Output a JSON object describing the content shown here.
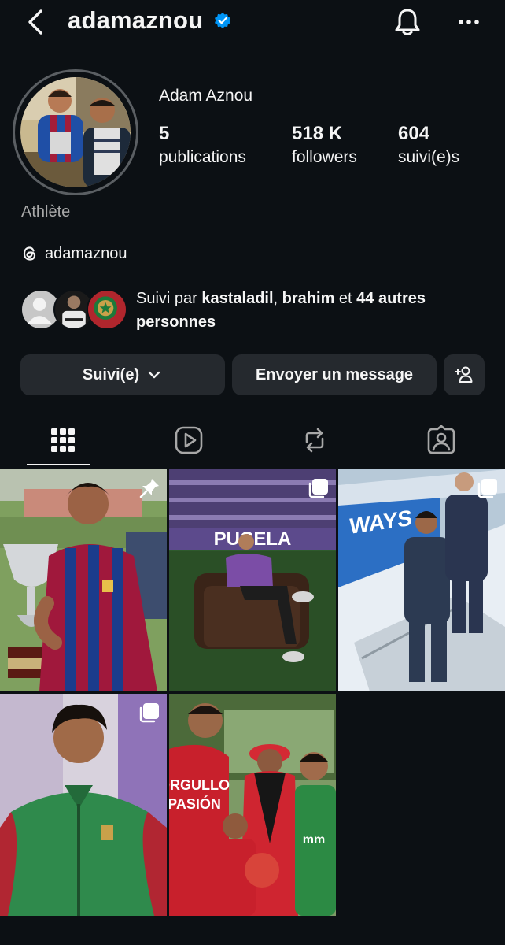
{
  "header": {
    "username": "adamaznou",
    "icons": [
      "back-icon",
      "verified-badge-icon",
      "bell-icon",
      "more-icon"
    ]
  },
  "profile": {
    "full_name": "Adam Aznou",
    "category": "Athlète",
    "stats": [
      {
        "value": "5",
        "label": "publications"
      },
      {
        "value": "518 K",
        "label": "followers"
      },
      {
        "value": "604",
        "label": "suivi(e)s"
      }
    ],
    "threads_handle": "adamaznou"
  },
  "followed_by": {
    "prefix": "Suivi par ",
    "user1": "kastaladil",
    "sep": ", ",
    "user2": "brahim",
    "conj": " et ",
    "others": "44 autres personnes"
  },
  "actions": {
    "following_label": "Suivi(e)",
    "message_label": "Envoyer un message"
  },
  "tabs": [
    "grid-icon",
    "reels-icon",
    "reposts-icon",
    "tagged-icon"
  ],
  "posts": [
    {
      "subject": "trophy celebration",
      "badge": "pin-icon"
    },
    {
      "subject": "stadium armchair",
      "badge": "multi-photo-icon"
    },
    {
      "subject": "airplane stairs",
      "badge": "multi-photo-icon"
    },
    {
      "subject": "green Morocco jacket",
      "badge": "multi-photo-icon"
    },
    {
      "subject": "family photo",
      "badge": ""
    }
  ],
  "post_texts": {
    "sign1": "PUCELA",
    "plane": "WAYS",
    "shirt1": "ORGULLO",
    "shirt2": "PASIÓN",
    "shirt3": "mm"
  },
  "colors": {
    "background": "#0c1014",
    "button": "#25292e",
    "muted": "#a8a8a8",
    "verified": "#0095f6"
  }
}
